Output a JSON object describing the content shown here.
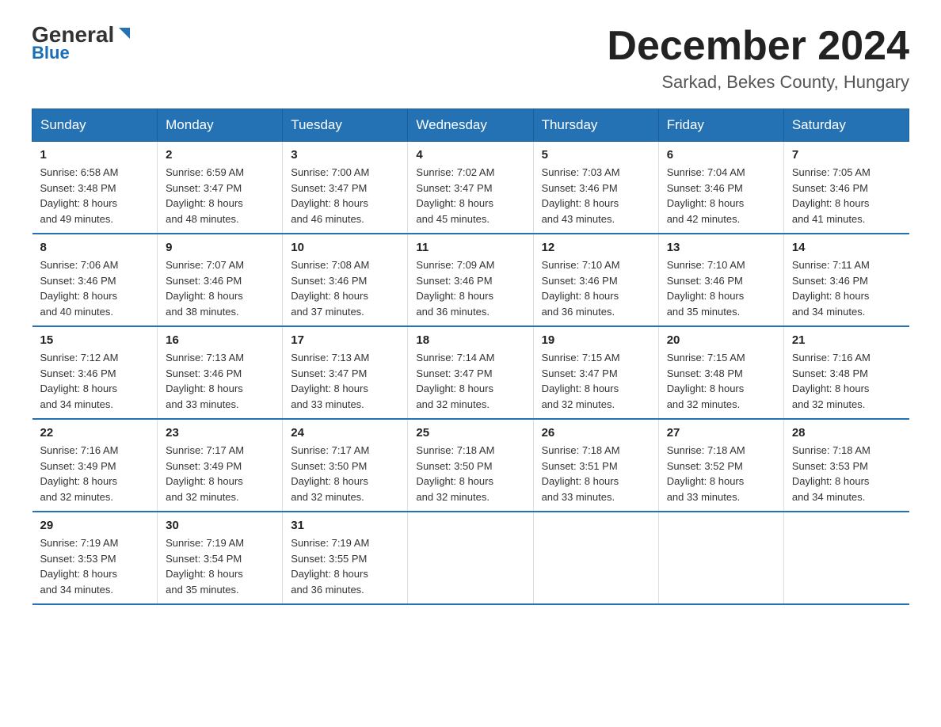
{
  "header": {
    "logo_general": "General",
    "logo_blue": "Blue",
    "title": "December 2024",
    "subtitle": "Sarkad, Bekes County, Hungary"
  },
  "days_of_week": [
    "Sunday",
    "Monday",
    "Tuesday",
    "Wednesday",
    "Thursday",
    "Friday",
    "Saturday"
  ],
  "weeks": [
    [
      {
        "day": "1",
        "sunrise": "6:58 AM",
        "sunset": "3:48 PM",
        "daylight": "8 hours and 49 minutes."
      },
      {
        "day": "2",
        "sunrise": "6:59 AM",
        "sunset": "3:47 PM",
        "daylight": "8 hours and 48 minutes."
      },
      {
        "day": "3",
        "sunrise": "7:00 AM",
        "sunset": "3:47 PM",
        "daylight": "8 hours and 46 minutes."
      },
      {
        "day": "4",
        "sunrise": "7:02 AM",
        "sunset": "3:47 PM",
        "daylight": "8 hours and 45 minutes."
      },
      {
        "day": "5",
        "sunrise": "7:03 AM",
        "sunset": "3:46 PM",
        "daylight": "8 hours and 43 minutes."
      },
      {
        "day": "6",
        "sunrise": "7:04 AM",
        "sunset": "3:46 PM",
        "daylight": "8 hours and 42 minutes."
      },
      {
        "day": "7",
        "sunrise": "7:05 AM",
        "sunset": "3:46 PM",
        "daylight": "8 hours and 41 minutes."
      }
    ],
    [
      {
        "day": "8",
        "sunrise": "7:06 AM",
        "sunset": "3:46 PM",
        "daylight": "8 hours and 40 minutes."
      },
      {
        "day": "9",
        "sunrise": "7:07 AM",
        "sunset": "3:46 PM",
        "daylight": "8 hours and 38 minutes."
      },
      {
        "day": "10",
        "sunrise": "7:08 AM",
        "sunset": "3:46 PM",
        "daylight": "8 hours and 37 minutes."
      },
      {
        "day": "11",
        "sunrise": "7:09 AM",
        "sunset": "3:46 PM",
        "daylight": "8 hours and 36 minutes."
      },
      {
        "day": "12",
        "sunrise": "7:10 AM",
        "sunset": "3:46 PM",
        "daylight": "8 hours and 36 minutes."
      },
      {
        "day": "13",
        "sunrise": "7:10 AM",
        "sunset": "3:46 PM",
        "daylight": "8 hours and 35 minutes."
      },
      {
        "day": "14",
        "sunrise": "7:11 AM",
        "sunset": "3:46 PM",
        "daylight": "8 hours and 34 minutes."
      }
    ],
    [
      {
        "day": "15",
        "sunrise": "7:12 AM",
        "sunset": "3:46 PM",
        "daylight": "8 hours and 34 minutes."
      },
      {
        "day": "16",
        "sunrise": "7:13 AM",
        "sunset": "3:46 PM",
        "daylight": "8 hours and 33 minutes."
      },
      {
        "day": "17",
        "sunrise": "7:13 AM",
        "sunset": "3:47 PM",
        "daylight": "8 hours and 33 minutes."
      },
      {
        "day": "18",
        "sunrise": "7:14 AM",
        "sunset": "3:47 PM",
        "daylight": "8 hours and 32 minutes."
      },
      {
        "day": "19",
        "sunrise": "7:15 AM",
        "sunset": "3:47 PM",
        "daylight": "8 hours and 32 minutes."
      },
      {
        "day": "20",
        "sunrise": "7:15 AM",
        "sunset": "3:48 PM",
        "daylight": "8 hours and 32 minutes."
      },
      {
        "day": "21",
        "sunrise": "7:16 AM",
        "sunset": "3:48 PM",
        "daylight": "8 hours and 32 minutes."
      }
    ],
    [
      {
        "day": "22",
        "sunrise": "7:16 AM",
        "sunset": "3:49 PM",
        "daylight": "8 hours and 32 minutes."
      },
      {
        "day": "23",
        "sunrise": "7:17 AM",
        "sunset": "3:49 PM",
        "daylight": "8 hours and 32 minutes."
      },
      {
        "day": "24",
        "sunrise": "7:17 AM",
        "sunset": "3:50 PM",
        "daylight": "8 hours and 32 minutes."
      },
      {
        "day": "25",
        "sunrise": "7:18 AM",
        "sunset": "3:50 PM",
        "daylight": "8 hours and 32 minutes."
      },
      {
        "day": "26",
        "sunrise": "7:18 AM",
        "sunset": "3:51 PM",
        "daylight": "8 hours and 33 minutes."
      },
      {
        "day": "27",
        "sunrise": "7:18 AM",
        "sunset": "3:52 PM",
        "daylight": "8 hours and 33 minutes."
      },
      {
        "day": "28",
        "sunrise": "7:18 AM",
        "sunset": "3:53 PM",
        "daylight": "8 hours and 34 minutes."
      }
    ],
    [
      {
        "day": "29",
        "sunrise": "7:19 AM",
        "sunset": "3:53 PM",
        "daylight": "8 hours and 34 minutes."
      },
      {
        "day": "30",
        "sunrise": "7:19 AM",
        "sunset": "3:54 PM",
        "daylight": "8 hours and 35 minutes."
      },
      {
        "day": "31",
        "sunrise": "7:19 AM",
        "sunset": "3:55 PM",
        "daylight": "8 hours and 36 minutes."
      },
      null,
      null,
      null,
      null
    ]
  ],
  "labels": {
    "sunrise": "Sunrise:",
    "sunset": "Sunset:",
    "daylight": "Daylight:"
  },
  "colors": {
    "header_bg": "#2472b3",
    "header_text": "#ffffff",
    "border": "#2472b3"
  }
}
